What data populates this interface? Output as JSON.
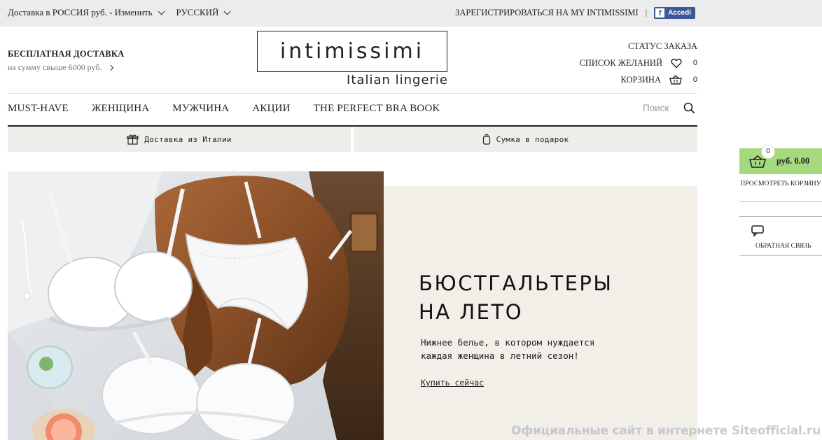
{
  "topbar": {
    "delivery_text": "Доставка в РОССИЯ  руб. - Изменить",
    "language": "РУССКИЙ",
    "register": "ЗАРЕГИСТРИРОВАТЬСЯ НА MY INTIMISSIMI",
    "separator": "|",
    "facebook_label": "Accedi"
  },
  "free_shipping": {
    "title": "БЕСПЛАТНАЯ ДОСТАВКА",
    "subtitle": "на сумму свыше 6000 руб."
  },
  "logo": {
    "wordmark": "intimissimi",
    "tagline": "Italian lingerie"
  },
  "account": {
    "order_status": "СТАТУС ЗАКАЗА",
    "wishlist": "СПИСОК ЖЕЛАНИЙ",
    "wishlist_count": "0",
    "cart": "КОРЗИНА",
    "cart_count": "0"
  },
  "nav": {
    "items": [
      "MUST-HAVE",
      "ЖЕНЩИНА",
      "МУЖЧИНА",
      "АКЦИИ",
      "THE PERFECT BRA BOOK"
    ],
    "search_placeholder": "Поиск"
  },
  "promo": {
    "left": "Доставка из Италии",
    "right": "Сумка в подарок"
  },
  "hero": {
    "title_line1": "БЮСТГАЛЬТЕРЫ",
    "title_line2": "НА ЛЕТО",
    "text_line1": "Нижнее белье, в котором нуждается",
    "text_line2": "каждая женщина в летний сезон!",
    "cta": "Купить сейчас"
  },
  "side_widget": {
    "cart_count": "0",
    "cart_amount": "руб. 0.00",
    "view_cart": "ПРОСМОТРЕТЬ КОРЗИНУ",
    "feedback": "ОБРАТНАЯ СВЯЗЬ",
    "accent_color": "#a6d97e"
  },
  "watermark": "Официальные сайт в интернете Siteofficial.ru",
  "colors": {
    "topbar_bg": "#ececec",
    "promo_bg": "#efedea",
    "hero_panel_bg": "#f2eee8",
    "facebook": "#3b5998"
  }
}
